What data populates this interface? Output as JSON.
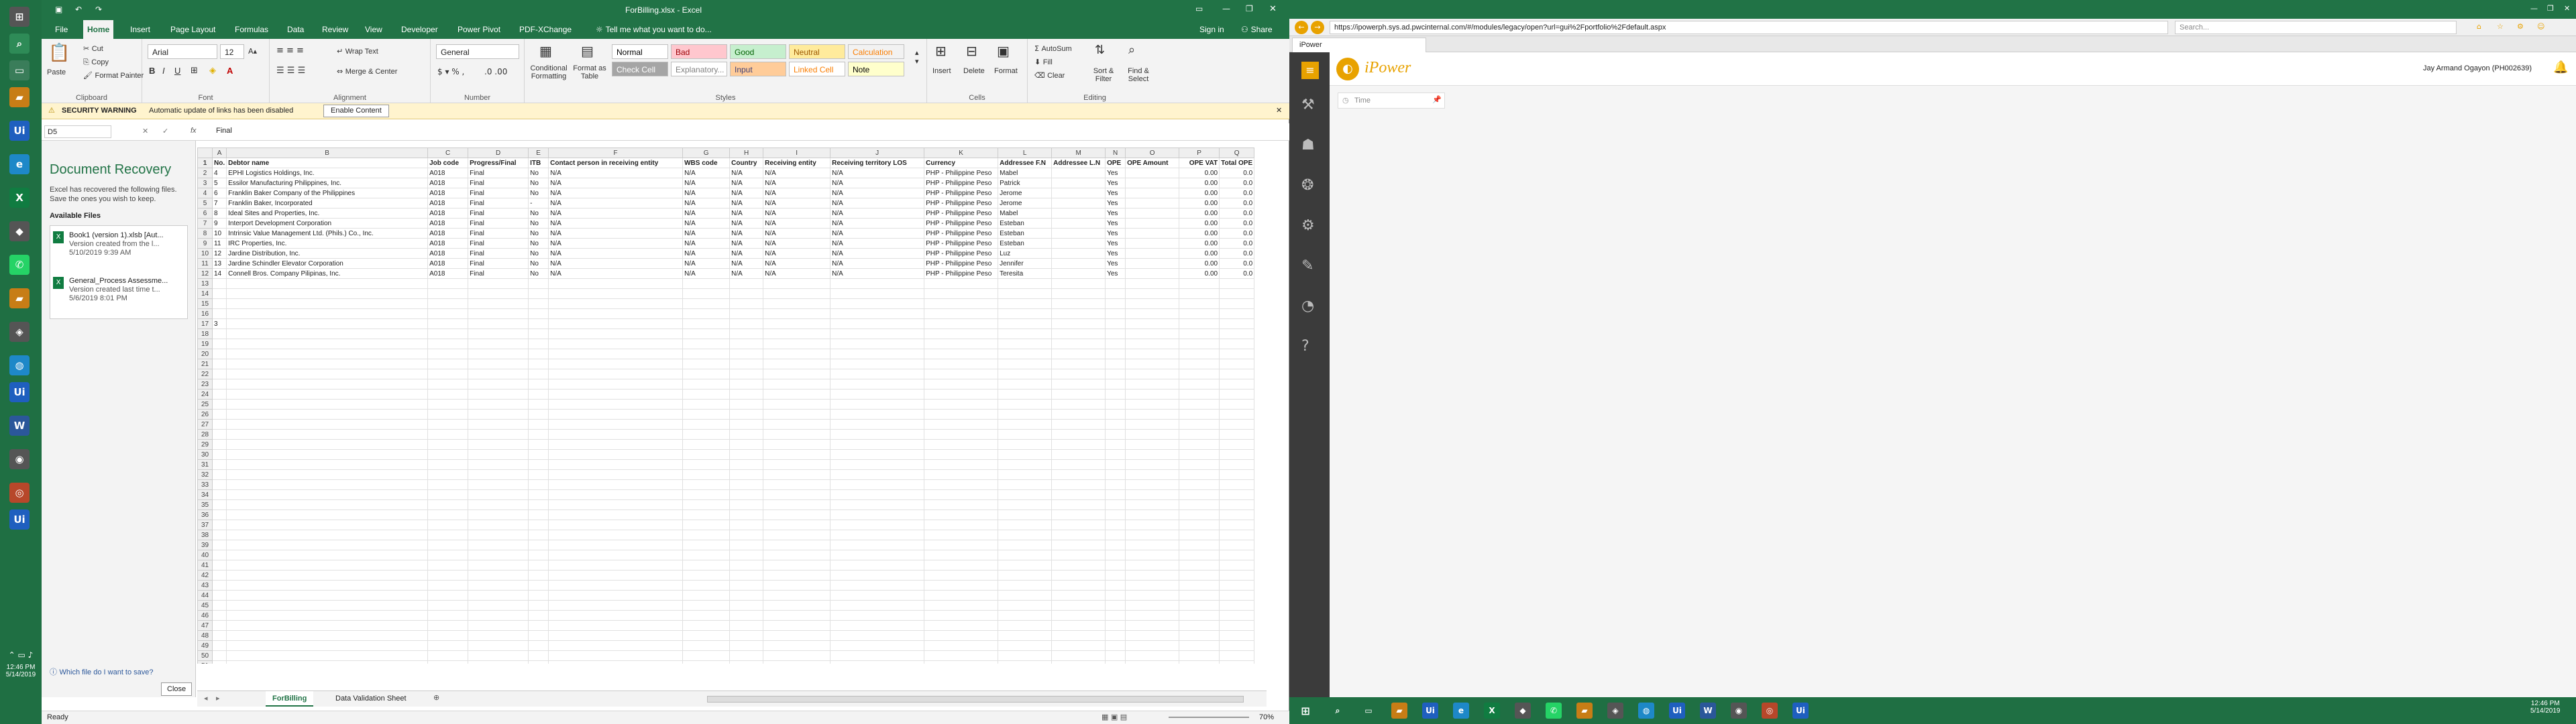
{
  "excel": {
    "title": "ForBilling.xlsx - Excel",
    "signin": "Sign in",
    "share": "Share",
    "tabs": [
      "File",
      "Home",
      "Insert",
      "Page Layout",
      "Formulas",
      "Data",
      "Review",
      "View",
      "Developer",
      "Power Pivot",
      "PDF-XChange"
    ],
    "tellme": "Tell me what you want to do...",
    "ribbon": {
      "clipboard": {
        "label": "Clipboard",
        "paste": "Paste",
        "cut": "Cut",
        "copy": "Copy",
        "painter": "Format Painter"
      },
      "font": {
        "label": "Font",
        "name": "Arial",
        "size": "12"
      },
      "alignment": {
        "label": "Alignment",
        "wrap": "Wrap Text",
        "merge": "Merge & Center"
      },
      "number": {
        "label": "Number",
        "format": "General"
      },
      "styles": {
        "label": "Styles",
        "conditional": "Conditional Formatting",
        "format_table": "Format as Table",
        "cells": [
          {
            "text": "Normal",
            "bg": "#ffffff",
            "fg": "#000000"
          },
          {
            "text": "Bad",
            "bg": "#ffc7ce",
            "fg": "#9c0006"
          },
          {
            "text": "Good",
            "bg": "#c6efce",
            "fg": "#006100"
          },
          {
            "text": "Neutral",
            "bg": "#ffeb9c",
            "fg": "#9c5700"
          },
          {
            "text": "Calculation",
            "bg": "#f2f2f2",
            "fg": "#fa7d00"
          },
          {
            "text": "Check Cell",
            "bg": "#a5a5a5",
            "fg": "#ffffff"
          },
          {
            "text": "Explanatory...",
            "bg": "#ffffff",
            "fg": "#7f7f7f"
          },
          {
            "text": "Input",
            "bg": "#ffcc99",
            "fg": "#3f3f76"
          },
          {
            "text": "Linked Cell",
            "bg": "#ffffff",
            "fg": "#fa7d00"
          },
          {
            "text": "Note",
            "bg": "#ffffcc",
            "fg": "#000000"
          }
        ]
      },
      "cells": {
        "label": "Cells",
        "insert": "Insert",
        "delete": "Delete",
        "format": "Format"
      },
      "editing": {
        "label": "Editing",
        "autosum": "AutoSum",
        "fill": "Fill",
        "clear": "Clear",
        "sort": "Sort & Filter",
        "find": "Find & Select"
      }
    },
    "security": {
      "label": "SECURITY WARNING",
      "message": "Automatic update of links has been disabled",
      "button": "Enable Content"
    },
    "namebox": "D5",
    "formula": "Final",
    "recovery": {
      "title": "Document Recovery",
      "desc": "Excel has recovered the following files. Save the ones you wish to keep.",
      "available": "Available Files",
      "files": [
        {
          "name": "Book1 (version 1).xlsb [Aut...",
          "desc": "Version created from the l...",
          "date": "5/10/2019 9:39 AM"
        },
        {
          "name": "General_Process Assessme...",
          "desc": "Version created last time t...",
          "date": "5/6/2019 8:01 PM"
        }
      ],
      "which": "Which file do I want to save?",
      "close": "Close"
    },
    "columns": [
      "A",
      "B",
      "C",
      "D",
      "E",
      "F",
      "G",
      "H",
      "I",
      "J",
      "K",
      "L",
      "M",
      "N",
      "O",
      "P",
      "Q"
    ],
    "headers": [
      "No.",
      "Debtor name",
      "Job code",
      "Progress/Final",
      "ITB",
      "Contact person in receiving entity",
      "WBS code",
      "Country",
      "Receiving entity",
      "Receiving territory LOS",
      "Currency",
      "Addressee F.N",
      "Addressee L.N",
      "OPE",
      "OPE Amount",
      "OPE VAT",
      "Total OPE"
    ],
    "rows": [
      [
        "4",
        "EPHI Logistics Holdings, Inc.",
        "A018",
        "Final",
        "No",
        "N/A",
        "N/A",
        "N/A",
        "N/A",
        "N/A",
        "PHP - Philippine Peso",
        "Mabel",
        "",
        "Yes",
        "",
        "0.00",
        "0.0"
      ],
      [
        "5",
        "Essilor Manufacturing Philippines, Inc.",
        "A018",
        "Final",
        "No",
        "N/A",
        "N/A",
        "N/A",
        "N/A",
        "N/A",
        "PHP - Philippine Peso",
        "Patrick",
        "",
        "Yes",
        "",
        "0.00",
        "0.0"
      ],
      [
        "6",
        "Franklin Baker Company of the Philippines",
        "A018",
        "Final",
        "No",
        "N/A",
        "N/A",
        "N/A",
        "N/A",
        "N/A",
        "PHP - Philippine Peso",
        "Jerome",
        "",
        "Yes",
        "",
        "0.00",
        "0.0"
      ],
      [
        "7",
        "Franklin Baker, Incorporated",
        "A018",
        "Final",
        "-",
        "N/A",
        "N/A",
        "N/A",
        "N/A",
        "N/A",
        "PHP - Philippine Peso",
        "Jerome",
        "",
        "Yes",
        "",
        "0.00",
        "0.0"
      ],
      [
        "8",
        "Ideal Sites and Properties, Inc.",
        "A018",
        "Final",
        "No",
        "N/A",
        "N/A",
        "N/A",
        "N/A",
        "N/A",
        "PHP - Philippine Peso",
        "Mabel",
        "",
        "Yes",
        "",
        "0.00",
        "0.0"
      ],
      [
        "9",
        "Interport Development Corporation",
        "A018",
        "Final",
        "No",
        "N/A",
        "N/A",
        "N/A",
        "N/A",
        "N/A",
        "PHP - Philippine Peso",
        "Esteban",
        "",
        "Yes",
        "",
        "0.00",
        "0.0"
      ],
      [
        "10",
        "Intrinsic Value Management Ltd. (Phils.) Co., Inc.",
        "A018",
        "Final",
        "No",
        "N/A",
        "N/A",
        "N/A",
        "N/A",
        "N/A",
        "PHP - Philippine Peso",
        "Esteban",
        "",
        "Yes",
        "",
        "0.00",
        "0.0"
      ],
      [
        "11",
        "IRC Properties, Inc.",
        "A018",
        "Final",
        "No",
        "N/A",
        "N/A",
        "N/A",
        "N/A",
        "N/A",
        "PHP - Philippine Peso",
        "Esteban",
        "",
        "Yes",
        "",
        "0.00",
        "0.0"
      ],
      [
        "12",
        "Jardine Distribution, Inc.",
        "A018",
        "Final",
        "No",
        "N/A",
        "N/A",
        "N/A",
        "N/A",
        "N/A",
        "PHP - Philippine Peso",
        "Luz",
        "",
        "Yes",
        "",
        "0.00",
        "0.0"
      ],
      [
        "13",
        "Jardine Schindler Elevator Corporation",
        "A018",
        "Final",
        "No",
        "N/A",
        "N/A",
        "N/A",
        "N/A",
        "N/A",
        "PHP - Philippine Peso",
        "Jennifer",
        "",
        "Yes",
        "",
        "0.00",
        "0.0"
      ],
      [
        "14",
        "Connell Bros. Company Pilipinas, Inc.",
        "A018",
        "Final",
        "No",
        "N/A",
        "N/A",
        "N/A",
        "N/A",
        "N/A",
        "PHP - Philippine Peso",
        "Teresita",
        "",
        "Yes",
        "",
        "0.00",
        "0.0"
      ]
    ],
    "col_a_values": {
      "15": "",
      "16": "",
      "17": "",
      "18": "",
      "19": "3",
      "20": "",
      "21": "",
      "22": "",
      "23": "",
      "24": "",
      "25": "",
      "26": "",
      "27": "",
      "28": "",
      "29": "",
      "30": "",
      "31": "",
      "32": "",
      "33": "",
      "34": "",
      "35": "",
      "36": "",
      "37": "",
      "38": "",
      "39": "",
      "40": "",
      "41": "",
      "42": "",
      "43": "",
      "44": "",
      "45": "",
      "46": "",
      "47": "",
      "48": "",
      "49": "",
      "50": ""
    },
    "sheets": [
      "ForBilling",
      "Data Validation Sheet"
    ],
    "status": "Ready",
    "zoom": "70%"
  },
  "browser": {
    "url": "https://ipowerph.sys.ad.pwcinternal.com/#/modules/legacy/open?url=gui%2Fportfolio%2Fdefault.aspx",
    "search": "Search...",
    "tab": "iPower",
    "brand": "iPower",
    "user": "Jay Armand Ogayon (PH002639)",
    "time_label": "Time"
  },
  "taskbar": {
    "time": "12:46 PM",
    "date": "5/14/2019"
  }
}
